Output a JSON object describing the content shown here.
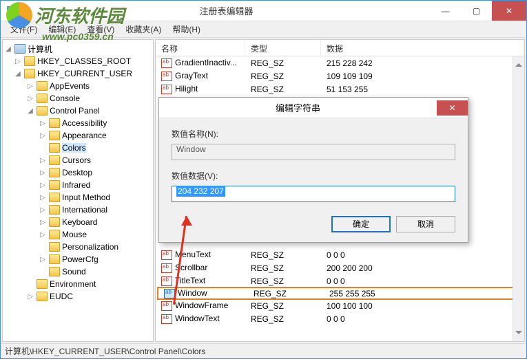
{
  "window": {
    "title": "注册表编辑器",
    "btn_min": "—",
    "btn_max": "▢",
    "btn_close": "✕"
  },
  "watermark": {
    "text": "河东软件园",
    "url": "www.pc0359.cn"
  },
  "menu": {
    "file": "文件(F)",
    "edit": "编辑(E)",
    "view": "查看(V)",
    "fav": "收藏夹(A)",
    "help": "帮助(H)"
  },
  "tree": {
    "root": "计算机",
    "hkcr": "HKEY_CLASSES_ROOT",
    "hkcu": "HKEY_CURRENT_USER",
    "items": {
      "appevents": "AppEvents",
      "console": "Console",
      "controlpanel": "Control Panel",
      "accessibility": "Accessibility",
      "appearance": "Appearance",
      "colors": "Colors",
      "cursors": "Cursors",
      "desktop": "Desktop",
      "infrared": "Infrared",
      "inputmethod": "Input Method",
      "international": "International",
      "keyboard": "Keyboard",
      "mouse": "Mouse",
      "personalization": "Personalization",
      "powercfg": "PowerCfg",
      "sound": "Sound",
      "environment": "Environment",
      "eudc": "EUDC"
    }
  },
  "list": {
    "headers": {
      "name": "名称",
      "type": "类型",
      "data": "数据"
    },
    "rows": [
      {
        "name": "GradientInactiv...",
        "type": "REG_SZ",
        "data": "215 228 242"
      },
      {
        "name": "GrayText",
        "type": "REG_SZ",
        "data": "109 109 109"
      },
      {
        "name": "Hilight",
        "type": "REG_SZ",
        "data": "51 153 255"
      },
      {
        "name": "MenuText",
        "type": "REG_SZ",
        "data": "0 0 0"
      },
      {
        "name": "Scrollbar",
        "type": "REG_SZ",
        "data": "200 200 200"
      },
      {
        "name": "TitleText",
        "type": "REG_SZ",
        "data": "0 0 0"
      },
      {
        "name": "Window",
        "type": "REG_SZ",
        "data": "255 255 255"
      },
      {
        "name": "WindowFrame",
        "type": "REG_SZ",
        "data": "100 100 100"
      },
      {
        "name": "WindowText",
        "type": "REG_SZ",
        "data": "0 0 0"
      }
    ]
  },
  "dialog": {
    "title": "编辑字符串",
    "close": "✕",
    "name_label": "数值名称(N):",
    "name_value": "Window",
    "data_label": "数值数据(V):",
    "data_value": "204 232 207",
    "ok": "确定",
    "cancel": "取消"
  },
  "statusbar": "计算机\\HKEY_CURRENT_USER\\Control Panel\\Colors"
}
